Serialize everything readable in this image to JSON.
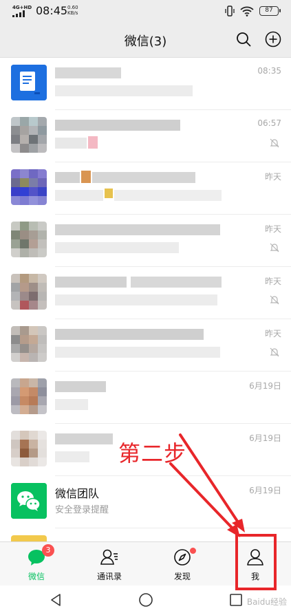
{
  "status_bar": {
    "network": "4G+HD",
    "time": "08:45",
    "speed_value": "0.60",
    "speed_unit": "KB/s",
    "battery": "87"
  },
  "header": {
    "title": "微信(3)",
    "icons": [
      "search-icon",
      "add-icon"
    ]
  },
  "chats": [
    {
      "name": "",
      "preview": "",
      "time": "08:35",
      "muted": false,
      "avatar": "document-app-icon"
    },
    {
      "name": "",
      "preview": "",
      "time": "06:57",
      "muted": true,
      "avatar": "pixelated"
    },
    {
      "name": "",
      "preview": "",
      "time": "昨天",
      "muted": false,
      "avatar": "pixelated"
    },
    {
      "name": "",
      "preview": "",
      "time": "昨天",
      "muted": true,
      "avatar": "pixelated"
    },
    {
      "name": "",
      "preview": "",
      "time": "昨天",
      "muted": true,
      "avatar": "pixelated"
    },
    {
      "name": "",
      "preview": "",
      "time": "昨天",
      "muted": true,
      "avatar": "pixelated"
    },
    {
      "name": "",
      "preview": "",
      "time": "6月19日",
      "muted": false,
      "avatar": "pixelated"
    },
    {
      "name": "",
      "preview": "",
      "time": "6月19日",
      "muted": false,
      "avatar": "pixelated"
    },
    {
      "name": "微信团队",
      "preview": "安全登录提醒",
      "time": "6月19日",
      "muted": false,
      "avatar": "wechat-logo-icon"
    }
  ],
  "annotation": {
    "text": "第二步",
    "color": "#e8262a"
  },
  "tabs": [
    {
      "label": "微信",
      "icon": "chat-icon",
      "active": true,
      "badge": "3"
    },
    {
      "label": "通讯录",
      "icon": "contacts-icon",
      "active": false
    },
    {
      "label": "发现",
      "icon": "compass-icon",
      "active": false,
      "dot": true
    },
    {
      "label": "我",
      "icon": "person-icon",
      "active": false
    }
  ],
  "nav": [
    "back-icon",
    "home-icon",
    "recents-icon"
  ],
  "watermark": "Baidu经验",
  "colors": {
    "accent": "#07c160",
    "badge": "#fa5151",
    "annotation": "#e8262a"
  }
}
